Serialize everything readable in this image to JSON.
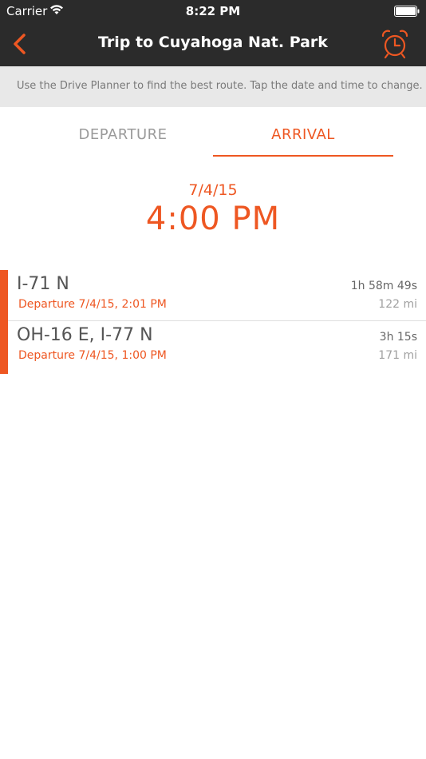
{
  "status_bar": {
    "carrier": "Carrier",
    "time": "8:22 PM"
  },
  "nav": {
    "title": "Trip to Cuyahoga Nat. Park",
    "back_icon": "chevron-left-icon",
    "alarm_icon": "alarm-clock-icon"
  },
  "info": {
    "text": "Use the Drive Planner to find the best route. Tap the date and time to change."
  },
  "tabs": [
    {
      "label": "DEPARTURE",
      "selected": false
    },
    {
      "label": "ARRIVAL",
      "selected": true
    }
  ],
  "arrival": {
    "date": "7/4/15",
    "time": "4:00 PM"
  },
  "routes": [
    {
      "name": "I-71 N",
      "departure": "Departure 7/4/15, 2:01 PM",
      "duration": "1h 58m 49s",
      "distance": "122 mi"
    },
    {
      "name": "OH-16 E, I-77 N",
      "departure": "Departure 7/4/15, 1:00 PM",
      "duration": "3h 15s",
      "distance": "171 mi"
    }
  ],
  "colors": {
    "accent": "#ee5722",
    "navbar": "#2b2b2b",
    "infobar": "#e8e8e8"
  }
}
